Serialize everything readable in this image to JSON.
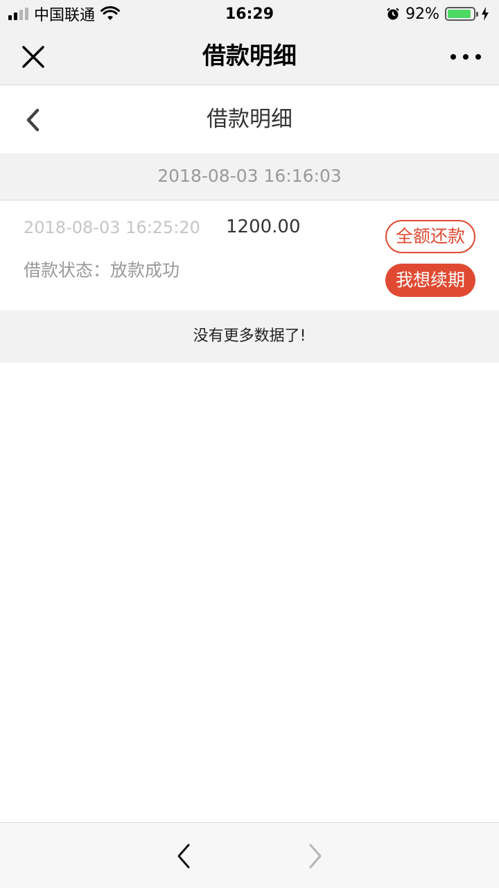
{
  "status_bar": {
    "carrier": "中国联通",
    "time": "16:29",
    "battery": "92%",
    "battery_level": 0.92,
    "icons": [
      "signal-icon",
      "wifi-icon",
      "alarm-icon",
      "battery-icon",
      "charging-icon"
    ]
  },
  "nav": {
    "title": "借款明细",
    "icons": [
      "close-icon",
      "more-icon"
    ]
  },
  "page": {
    "title": "借款明细",
    "back_icon": "chevron-left-icon"
  },
  "groups": [
    {
      "date": "2018-08-03 16:16:03",
      "records": [
        {
          "time": "2018-08-03 16:25:20",
          "amount": "1200.00",
          "status": "借款状态：放款成功",
          "repay_label": "全额还款",
          "renew_label": "我想续期"
        }
      ]
    }
  ],
  "no_more_text": "没有更多数据了!",
  "toolbar": {
    "icons": [
      "back-arrow-icon",
      "forward-arrow-icon"
    ]
  },
  "colors": {
    "accent": "#e04a32",
    "background_gray": "#f2f2f2",
    "battery_green": "#4cd964"
  }
}
